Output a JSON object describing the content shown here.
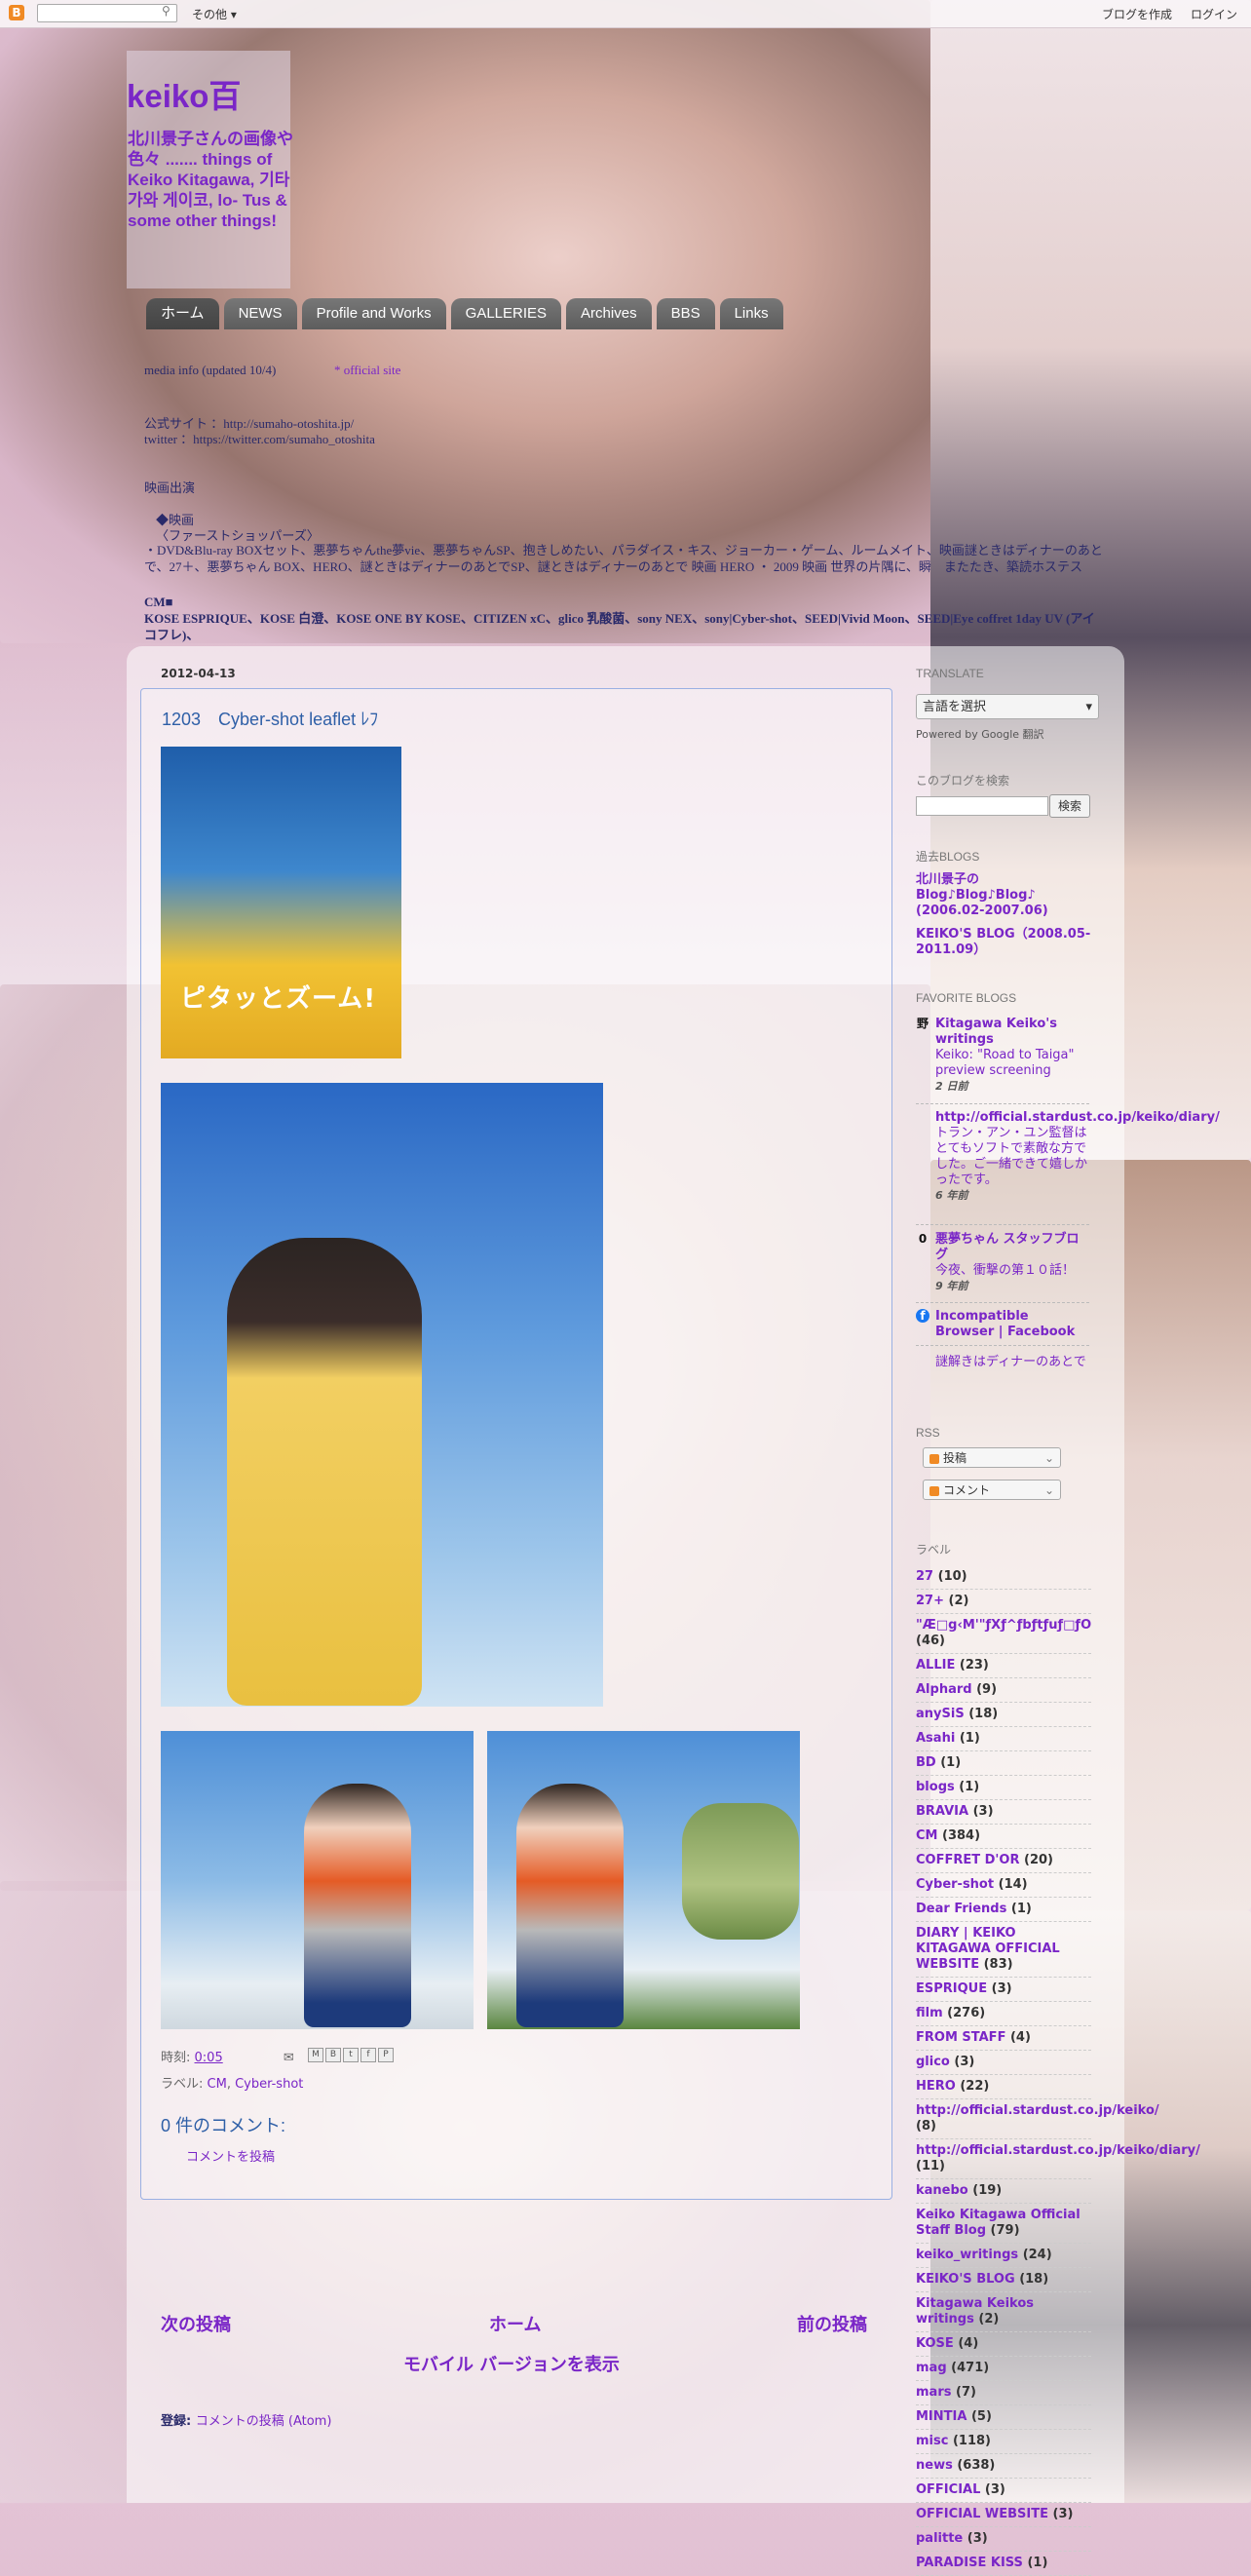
{
  "navbar": {
    "logo": "B",
    "more": "その他 ▾",
    "create": "ブログを作成",
    "login": "ログイン"
  },
  "header": {
    "title": "keiko百",
    "description": "北川景子さんの画像や色々 ....... things of Keiko Kitagawa, 기타가와 게이코, lo- Tus & some other things!",
    "tabs": [
      "ホーム",
      "NEWS",
      "Profile and Works",
      "GALLERIES",
      "Archives",
      "BBS",
      "Links"
    ],
    "lines": [
      "media info (updated 10/4)",
      "* official site",
      "公式サイト ：http://sumaho-otoshita.jp/",
      "twitter ：https://twitter.com/sumaho_otoshita",
      "映画出演",
      "◆映画",
      "〈ファーストショッパーズ〉",
      "・DVD&Blu-ray BOXセット、悪夢ちゃんthe夢vie、悪夢ちゃんSP、抱きしめたい、パラダイス・キス、ジョーカー・ゲーム、ルームメイト、映画謎ときはディナーのあとで、27＋、悪夢ちゃん BOX、HERO、謎ときはディナーのあとでSP、謎ときはディナーのあとで 映画 HERO ・ 2009 映画 世界の片隅に、瞬　またたき、築読ホステス",
      "CM■",
      "KOSE ESPRIQUE、KOSE 白澄、KOSE ONE BY KOSE、CITIZEN xC、glico 乳酸菌、sony NEX、sony|Cyber-shot、SEED|Vivid Moon、SEED|Eye coffret 1day UV (アイコフレ)、"
    ]
  },
  "post": {
    "date": "2012-04-13",
    "title": "1203　Cyber-shot leaflet ﾚﾌ",
    "image_text": "ピタッとズーム!",
    "footer_prefix": "時刻: ",
    "time": "0:05",
    "share_icons": [
      "email-icon",
      "blogthis-icon",
      "twitter-icon",
      "facebook-icon",
      "pinterest-icon"
    ],
    "labels_prefix": "ラベル: ",
    "labels": [
      "CM",
      "Cyber-shot"
    ],
    "comments_title": "0 件のコメント:",
    "comment_post": "コメントを投稿"
  },
  "pager": {
    "newer": "次の投稿",
    "home": "ホーム",
    "older": "前の投稿",
    "mobile": "モバイル バージョンを表示",
    "subscribe_prefix": "登録: ",
    "subscribe_link": "コメントの投稿 (Atom)"
  },
  "sidebar": {
    "translate_heading": "TRANSLATE",
    "translate_select": "言語を選択",
    "translate_powered": "Powered by Google 翻訳",
    "search_heading": "このブログを検索",
    "search_button": "検索",
    "past_heading": "過去BLOGS",
    "past_links": [
      "北川景子の Blog♪Blog♪Blog♪ (2006.02-2007.06)",
      "KEIKO'S BLOG（2008.05-2011.09）"
    ],
    "fav_heading": "FAVORITE BLOGS",
    "favorites": [
      {
        "icon": "野",
        "title": "Kitagawa Keiko's writings",
        "sub": "Keiko: \"Road to Taiga\" preview screening",
        "time": "2 日前"
      },
      {
        "icon": "",
        "title": "http://official.stardust.co.jp/keiko/diary/",
        "sub": "トラン・アン・ユン監督はとてもソフトで素敵な方でした。ご一緒できて嬉しかったです。",
        "time": "6 年前"
      },
      {
        "icon": "0",
        "title": "悪夢ちゃん スタッフブログ",
        "sub": "今夜、衝撃の第１０話！",
        "time": "9 年前"
      },
      {
        "icon": "f",
        "title": "Incompatible Browser | Facebook",
        "sub": "",
        "time": ""
      },
      {
        "icon": "",
        "title": "謎解きはディナーのあとで",
        "sub": "",
        "time": ""
      }
    ],
    "rss_heading": "RSS",
    "rss_posts": "投稿",
    "rss_comments": "コメント",
    "labels_heading": "ラベル",
    "labels": [
      {
        "name": "27",
        "count": "(10)"
      },
      {
        "name": "27+",
        "count": "(2)"
      },
      {
        "name": "\"Æ□g‹M'\"ƒXƒ^ƒbƒtƒuƒ□ƒO",
        "count": "(46)"
      },
      {
        "name": "ALLIE",
        "count": "(23)"
      },
      {
        "name": "Alphard",
        "count": "(9)"
      },
      {
        "name": "anySiS",
        "count": "(18)"
      },
      {
        "name": "Asahi",
        "count": "(1)"
      },
      {
        "name": "BD",
        "count": "(1)"
      },
      {
        "name": "blogs",
        "count": "(1)"
      },
      {
        "name": "BRAVIA",
        "count": "(3)"
      },
      {
        "name": "CM",
        "count": "(384)"
      },
      {
        "name": "COFFRET D'OR",
        "count": "(20)"
      },
      {
        "name": "Cyber-shot",
        "count": "(14)"
      },
      {
        "name": "Dear Friends",
        "count": "(1)"
      },
      {
        "name": "DIARY | KEIKO KITAGAWA OFFICIAL WEBSITE",
        "count": "(83)"
      },
      {
        "name": "ESPRIQUE",
        "count": "(3)"
      },
      {
        "name": "film",
        "count": "(276)"
      },
      {
        "name": "FROM STAFF",
        "count": "(4)"
      },
      {
        "name": "glico",
        "count": "(3)"
      },
      {
        "name": "HERO",
        "count": "(22)"
      },
      {
        "name": "http://official.stardust.co.jp/keiko/",
        "count": "(8)"
      },
      {
        "name": "http://official.stardust.co.jp/keiko/diary/",
        "count": "(11)"
      },
      {
        "name": "kanebo",
        "count": "(19)"
      },
      {
        "name": "Keiko Kitagawa Official Staff Blog",
        "count": "(79)"
      },
      {
        "name": "keiko_writings",
        "count": "(24)"
      },
      {
        "name": "KEIKO'S BLOG",
        "count": "(18)"
      },
      {
        "name": "Kitagawa Keikos writings",
        "count": "(2)"
      },
      {
        "name": "KOSE",
        "count": "(4)"
      },
      {
        "name": "mag",
        "count": "(471)"
      },
      {
        "name": "mars",
        "count": "(7)"
      },
      {
        "name": "MINTIA",
        "count": "(5)"
      },
      {
        "name": "misc",
        "count": "(118)"
      },
      {
        "name": "news",
        "count": "(638)"
      },
      {
        "name": "OFFICIAL",
        "count": "(3)"
      },
      {
        "name": "OFFICIAL WEBSITE",
        "count": "(3)"
      },
      {
        "name": "palitte",
        "count": "(3)"
      },
      {
        "name": "PARADISE KISS",
        "count": "(1)"
      }
    ]
  }
}
